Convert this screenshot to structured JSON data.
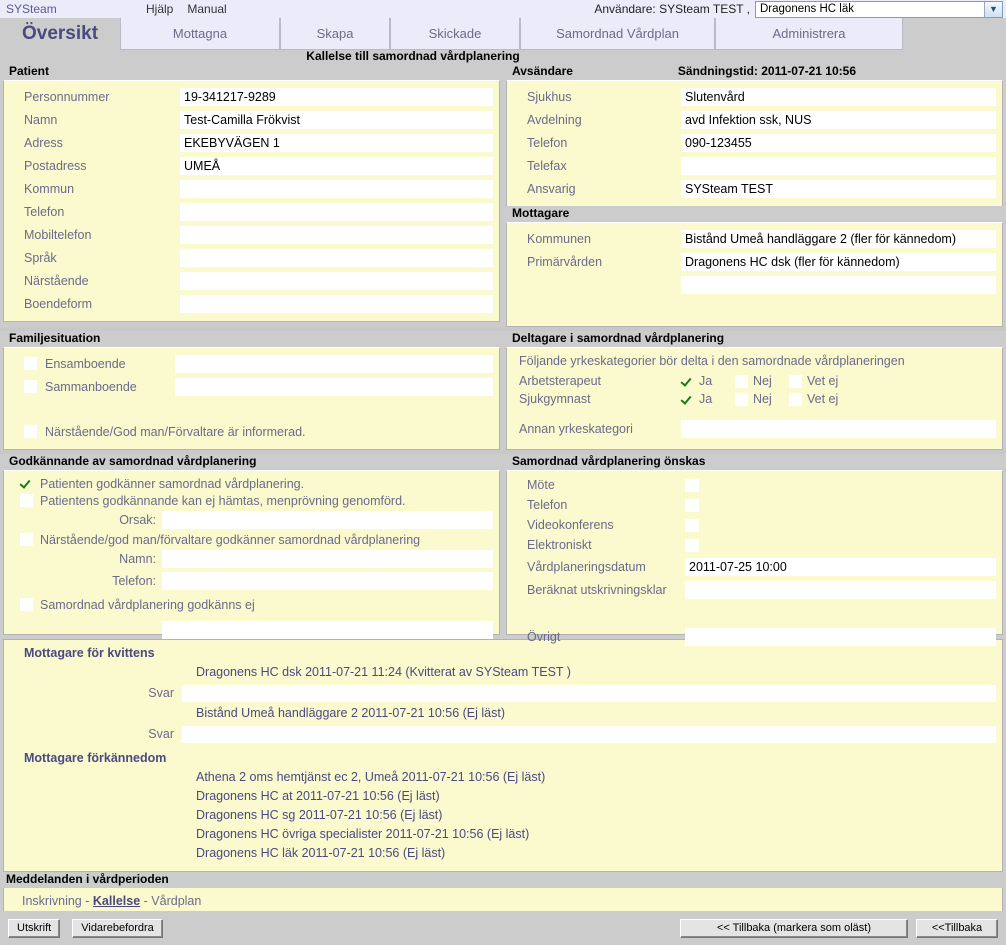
{
  "topbar": {
    "brand": "SYSteam",
    "menu": [
      {
        "label": "Hjälp"
      },
      {
        "label": "Manual"
      }
    ],
    "user_label": "Användare: SYSteam TEST ,",
    "unit_select": {
      "value": "Dragonens HC läk",
      "arrow": "chevron-down-icon"
    }
  },
  "tabs": [
    {
      "label": "Översikt",
      "active": true
    },
    {
      "label": "Mottagna",
      "active": false
    },
    {
      "label": "Skapa",
      "active": false
    },
    {
      "label": "Skickade",
      "active": false
    },
    {
      "label": "Samordnad Vårdplan",
      "active": false
    },
    {
      "label": "Administrera",
      "active": false
    }
  ],
  "document_title": "Kallelse till samordnad vårdplanering",
  "patient": {
    "heading": "Patient",
    "fields": [
      {
        "label": "Personnummer",
        "value": "19-341217-9289"
      },
      {
        "label": "Namn",
        "value": "Test-Camilla  Frökvist"
      },
      {
        "label": "Adress",
        "value": "EKEBYVÄGEN 1"
      },
      {
        "label": "Postadress",
        "value": " UMEÅ"
      },
      {
        "label": "Kommun",
        "value": ""
      },
      {
        "label": "Telefon",
        "value": ""
      },
      {
        "label": "Mobiltelefon",
        "value": ""
      },
      {
        "label": "Språk",
        "value": ""
      },
      {
        "label": "Närstående",
        "value": ""
      },
      {
        "label": "Boendeform",
        "value": ""
      }
    ]
  },
  "sender": {
    "heading": "Avsändare",
    "send_time": "Sändningstid: 2011-07-21 10:56",
    "fields": [
      {
        "label": "Sjukhus",
        "value": "Slutenvård"
      },
      {
        "label": "Avdelning",
        "value": "avd Infektion ssk, NUS"
      },
      {
        "label": "Telefon",
        "value": "090-123455"
      },
      {
        "label": "Telefax",
        "value": ""
      },
      {
        "label": "Ansvarig",
        "value": "SYSteam TEST"
      }
    ]
  },
  "receiver": {
    "heading": "Mottagare",
    "fields": [
      {
        "label": "Kommunen",
        "value": "Bistånd Umeå handläggare 2 (fler för kännedom)"
      },
      {
        "label": "Primärvården",
        "value": "Dragonens HC dsk (fler för kännedom)"
      },
      {
        "label": "",
        "value": ""
      }
    ]
  },
  "family": {
    "heading": "Familjesituation",
    "options": [
      {
        "label": "Ensamboende",
        "checked": false,
        "value": ""
      },
      {
        "label": "Sammanboende",
        "checked": false,
        "value": ""
      }
    ],
    "informed": {
      "label": "Närstående/God man/Förvaltare är informerad.",
      "checked": false
    }
  },
  "participants": {
    "heading": "Deltagare i samordnad vårdplanering",
    "intro": "Följande yrkeskategorier bör delta i den samordnade vårdplaneringen",
    "option_labels": {
      "yes": "Ja",
      "no": "Nej",
      "unknown": "Vet ej"
    },
    "rows": [
      {
        "label": "Arbetsterapeut",
        "yes": true,
        "no": false,
        "unknown": false
      },
      {
        "label": "Sjukgymnast",
        "yes": true,
        "no": false,
        "unknown": false
      }
    ],
    "other": {
      "label": "Annan yrkeskategori",
      "value": ""
    }
  },
  "approval": {
    "heading": "Godkännande av samordnad vårdplanering",
    "checks": [
      {
        "label": "Patienten godkänner samordnad vårdplanering.",
        "checked": true
      },
      {
        "label": "Patientens godkännande kan ej hämtas, menprövning genomförd.",
        "checked": false
      }
    ],
    "orsak": {
      "label": "Orsak:",
      "value": ""
    },
    "relative_check": {
      "label": "Närstående/god man/förvaltare godkänner samordnad vårdplanering",
      "checked": false
    },
    "namn": {
      "label": "Namn:",
      "value": ""
    },
    "telefon": {
      "label": "Telefon:",
      "value": ""
    },
    "denied": {
      "label": "Samordnad vårdplanering godkänns ej",
      "checked": false
    },
    "denied_value": ""
  },
  "planning": {
    "heading": "Samordnad vårdplanering önskas",
    "modes": [
      {
        "label": "Möte",
        "checked": false
      },
      {
        "label": "Telefon",
        "checked": false
      },
      {
        "label": "Videokonferens",
        "checked": false
      },
      {
        "label": "Elektroniskt",
        "checked": false
      }
    ],
    "date": {
      "label": "Vårdplaneringsdatum",
      "value": "2011-07-25       10:00"
    },
    "discharge": {
      "label": "Beräknat utskrivningsklar",
      "value": ""
    },
    "other": {
      "label": "Övrigt",
      "value": ""
    }
  },
  "receipts": {
    "heading": "Mottagare för kvittens",
    "entries": [
      {
        "text": "Dragonens HC dsk  2011-07-21 11:24  (Kvitterat av SYSteam TEST )",
        "reply_label": "Svar",
        "reply_value": ""
      },
      {
        "text": "Bistånd Umeå handläggare 2  2011-07-21 10:56  (Ej läst)",
        "reply_label": "Svar",
        "reply_value": ""
      }
    ]
  },
  "notifications": {
    "heading": "Mottagare förkännedom",
    "entries": [
      {
        "text": "Athena 2 oms hemtjänst ec 2, Umeå  2011-07-21 10:56  (Ej läst)"
      },
      {
        "text": "Dragonens HC at  2011-07-21 10:56  (Ej läst)"
      },
      {
        "text": "Dragonens HC sg  2011-07-21 10:56  (Ej läst)"
      },
      {
        "text": "Dragonens HC övriga specialister  2011-07-21 10:56  (Ej läst)"
      },
      {
        "text": "Dragonens HC läk  2011-07-21 10:56  (Ej läst)"
      }
    ]
  },
  "messages": {
    "heading": "Meddelanden i vårdperioden",
    "items": [
      {
        "label": "Inskrivning",
        "active": false
      },
      {
        "label": "Kallelse",
        "active": true
      },
      {
        "label": "Vårdplan",
        "active": false
      }
    ],
    "separator": "-"
  },
  "footer": {
    "print_button": "Utskrift",
    "forward_button": "Vidarebefordra",
    "back_unread_button": "<< Tillbaka (markera som oläst)",
    "back_button": "<<Tillbaka"
  },
  "colors": {
    "panel_bg": "#fbf9ce",
    "chrome_bg": "#cccccc",
    "tab_bg": "#ecebfa",
    "label_text": "#6b6b8a",
    "check_green": "#1a7a1a"
  }
}
